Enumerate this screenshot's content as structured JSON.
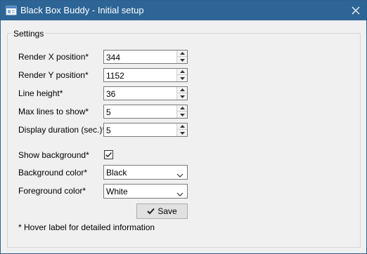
{
  "window": {
    "title": "Black Box Buddy - Initial setup",
    "close_icon": "close-icon",
    "app_icon": "app-icon"
  },
  "settings": {
    "group_label": "Settings",
    "render_x": {
      "label": "Render X position*",
      "value": "344"
    },
    "render_y": {
      "label": "Render Y position*",
      "value": "1152"
    },
    "line_height": {
      "label": "Line height*",
      "value": "36"
    },
    "max_lines": {
      "label": "Max lines to show*",
      "value": "5"
    },
    "display_duration": {
      "label": "Display duration (sec.)*",
      "value": "5"
    },
    "show_background": {
      "label": "Show background*",
      "checked": true
    },
    "background_color": {
      "label": "Background color*",
      "value": "Black"
    },
    "foreground_color": {
      "label": "Foreground color*",
      "value": "White"
    },
    "save_label": "Save",
    "note": "* Hover label for detailed information"
  },
  "colors": {
    "titlebar": "#2d6596",
    "window_bg": "#f0f0f0"
  }
}
